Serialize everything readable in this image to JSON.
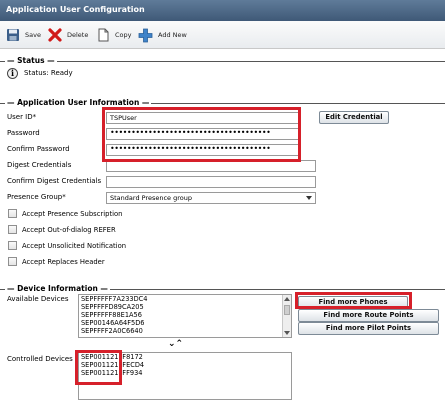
{
  "window": {
    "title": "Application User Configuration"
  },
  "toolbar": {
    "save_label": "Save",
    "delete_label": "Delete",
    "copy_label": "Copy",
    "add_new_label": "Add New"
  },
  "status": {
    "section_title": "Status",
    "text": "Status: Ready"
  },
  "user_info": {
    "section_title": "Application User Information",
    "user_id_label": "User ID",
    "user_id_value": "TSPUser",
    "password_label": "Password",
    "password_value": "••••••••••••••••••••••••••••••••••••••",
    "confirm_password_label": "Confirm Password",
    "confirm_password_value": "••••••••••••••••••••••••••••••••••••••",
    "digest_label": "Digest Credentials",
    "confirm_digest_label": "Confirm Digest Credentials",
    "presence_group_label": "Presence Group",
    "presence_group_value": "Standard Presence group",
    "edit_credential_label": "Edit Credential",
    "required_marker": "*",
    "checkboxes": [
      {
        "label": "Accept Presence Subscription",
        "checked": false
      },
      {
        "label": "Accept Out-of-dialog REFER",
        "checked": false
      },
      {
        "label": "Accept Unsolicited Notification",
        "checked": false
      },
      {
        "label": "Accept Replaces Header",
        "checked": false
      }
    ]
  },
  "device_info": {
    "section_title": "Device Information",
    "available_label": "Available Devices",
    "available_devices": [
      "SEPFFFFF7A233DC4",
      "SEPFFFFD89CA205",
      "SEPFFFFF88E1A56",
      "SEP00146A64F5D6",
      "SEPFFFF2A0C6640"
    ],
    "find_phones_label": "Find more Phones",
    "find_route_points_label": "Find more Route Points",
    "find_pilot_points_label": "Find more Pilot Points",
    "move_arrows": "⌄⌃",
    "controlled_label": "Controlled Devices",
    "controlled_devices": [
      "SEP001121FF8172",
      "SEP001121FFECD4",
      "SEP001121FFF934"
    ]
  },
  "colors": {
    "title_bar": "#4a6685",
    "highlight": "#d6202a",
    "delete_icon": "#d11a1a",
    "add_icon": "#3f83c9"
  }
}
